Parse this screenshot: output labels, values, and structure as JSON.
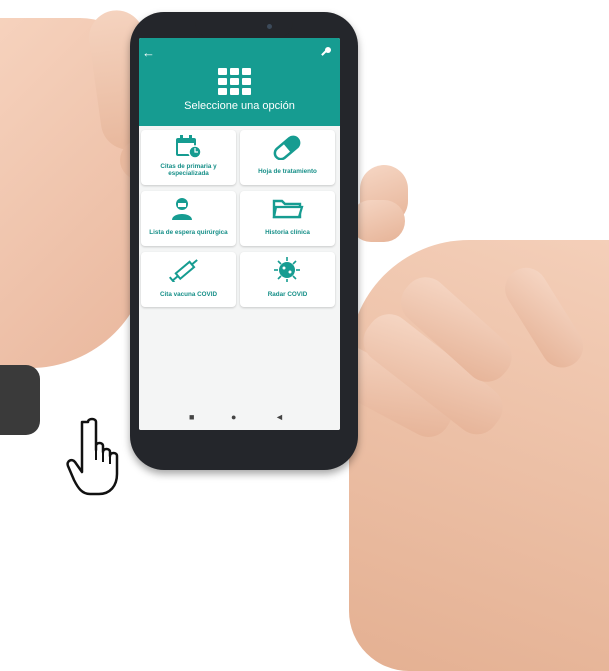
{
  "app": {
    "header_title": "Seleccione una opción",
    "icons": {
      "back": "back-arrow-icon",
      "key": "key-icon",
      "grid": "grid-icon"
    },
    "accent_color": "#169c91",
    "label_color": "#168f88"
  },
  "tiles": [
    {
      "label": "Citas de primaria y especializada",
      "icon": "calendar-clock-icon"
    },
    {
      "label": "Hoja de tratamiento",
      "icon": "pill-icon"
    },
    {
      "label": "Lista de espera quirúrgica",
      "icon": "surgeon-icon"
    },
    {
      "label": "Historia clínica",
      "icon": "folder-icon"
    },
    {
      "label": "Cita vacuna COVID",
      "icon": "syringe-icon"
    },
    {
      "label": "Radar COVID",
      "icon": "virus-icon"
    }
  ],
  "navbar": {
    "recents": "■",
    "home": "●",
    "back": "◄"
  }
}
